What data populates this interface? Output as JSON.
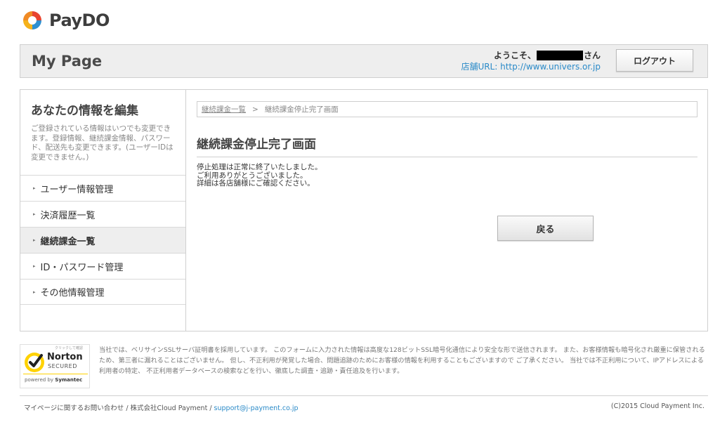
{
  "brand": {
    "name": "PayDO"
  },
  "header": {
    "page_title": "My Page",
    "welcome_prefix": "ようこそ、",
    "welcome_suffix": "さん",
    "shop_url_label": "店舗URL: ",
    "shop_url": "http://www.univers.or.jp",
    "logout_label": "ログアウト"
  },
  "sidebar": {
    "title": "あなたの情報を編集",
    "description": "ご登録されている情報はいつでも変更できます。登録情報、継続課金情報、パスワード、配送先も変更できます。(ユーザーIDは変更できません。)",
    "items": [
      {
        "label": "ユーザー情報管理"
      },
      {
        "label": "決済履歴一覧"
      },
      {
        "label": "継続課金一覧"
      },
      {
        "label": "ID・パスワード管理"
      },
      {
        "label": "その他情報管理"
      }
    ]
  },
  "content": {
    "breadcrumb_link": "継続課金一覧",
    "breadcrumb_separator": ">",
    "breadcrumb_current": "継続課金停止完了画面",
    "title": "継続課金停止完了画面",
    "message_lines": [
      "停止処理は正常に終了いたしました。",
      "ご利用ありがとうございました。",
      "詳細は各店舗様にご確認ください。"
    ],
    "back_label": "戻る"
  },
  "security": {
    "norton_small": "クリックして確認",
    "norton_name": "Norton",
    "norton_secured": "SECURED",
    "norton_powered_prefix": "powered by ",
    "norton_powered_brand": "Symantec",
    "text": "当社では、ベリサインSSLサーバ証明書を採用しています。 このフォームに入力された情報は高度な128ビットSSL暗号化通信により安全な形で送信されます。 また、お客様情報も暗号化され厳重に保管されるため、第三者に漏れることはございません。 但し、不正利用が発覚した場合、問題追跡のためにお客様の情報を利用することもございますので ご了承ください。 当社では不正利用について、IPアドレスによる利用者の特定、 不正利用者データベースの検索などを行い、徹底した調査・追跡・責任追及を行います。"
  },
  "footer": {
    "contact_text": "マイページに関するお問い合わせ / 株式会社Cloud Payment / ",
    "email": "support@j-payment.co.jp",
    "copyright": "(C)2015 Cloud Payment Inc."
  },
  "colors": {
    "link": "#2a8ac8",
    "logo_red": "#e8432e",
    "logo_yellow": "#f5b21b",
    "logo_blue": "#2d8fd0",
    "norton_yellow": "#ffd200"
  }
}
